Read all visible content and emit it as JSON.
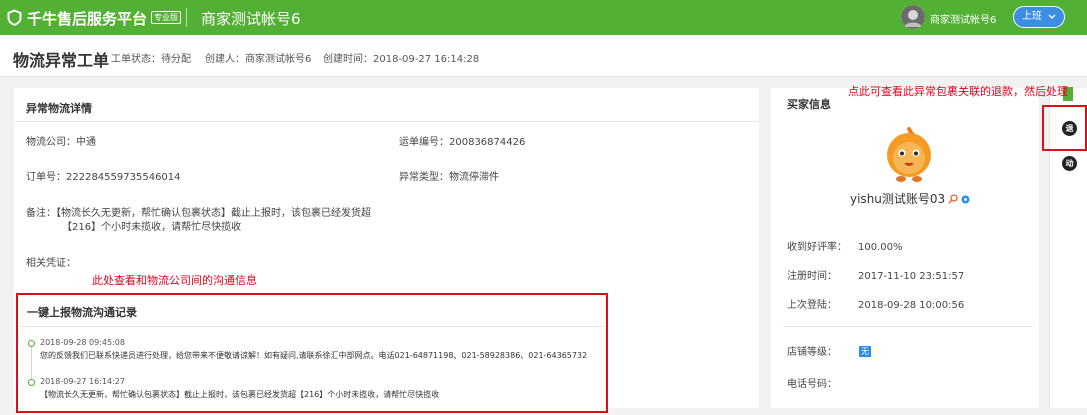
{
  "topbar": {
    "platform_name": "千牛售后服务平台",
    "env_badge": "专业版",
    "merchant_account": "商家测试帐号6",
    "user_name": "商家测试帐号6",
    "shift_button": "上班",
    "brand_color": "#52b035"
  },
  "header": {
    "title": "物流异常工单",
    "status": "工单状态：待分配",
    "creator": "创建人：商家测试帐号6",
    "created_at": "创建时间：2018-09-27 16:14:28"
  },
  "detail": {
    "section_title": "异常物流详情",
    "logistics_company": "物流公司：中通",
    "waybill_no": "运单编号：200836874426",
    "order_no": "订单号：222284559735546014",
    "exception_type": "异常类型：物流停滞件",
    "remark_line1": "备注：【物流长久无更新，帮忙确认包裹状态】截止上报时，该包裹已经发货超",
    "remark_line2": "【216】个小时未揽收，请帮忙尽快揽收",
    "evidence": "相关凭证："
  },
  "annotations": {
    "comm_hint": "此处查看和物流公司间的沟通信息",
    "refund_hint": "点此可查看此异常包裹关联的退款，然后处理"
  },
  "comm": {
    "title": "一键上报物流沟通记录",
    "records": [
      {
        "time": "2018-09-28 09:45:08",
        "text": "您的反馈我们已联系快递员进行处理，给您带来不便敬请谅解！如有疑问,请联系徐汇中部网点。电话021-64871198、021-58928386、021-64365732"
      },
      {
        "time": "2018-09-27 16:14:27",
        "text": "【物流长久无更新，帮忙确认包裹状态】截止上报时，该包裹已经发货超【216】个小时未揽收，请帮忙尽快揽收"
      }
    ]
  },
  "buyer": {
    "section_title": "买家信息",
    "nickname": "yishu测试账号03",
    "good_rate_label": "收到好评率：",
    "good_rate_value": "100.00%",
    "register_label": "注册时间：",
    "register_value": "2017-11-10 23:51:57",
    "last_login_label": "上次登陆：",
    "last_login_value": "2018-09-28 10:00:56",
    "shop_level_label": "店铺等级：",
    "shop_level_value": "无",
    "phone_label": "电话号码："
  },
  "side_rail": {
    "refund_icon_char": "退",
    "activity_icon_char": "动"
  }
}
